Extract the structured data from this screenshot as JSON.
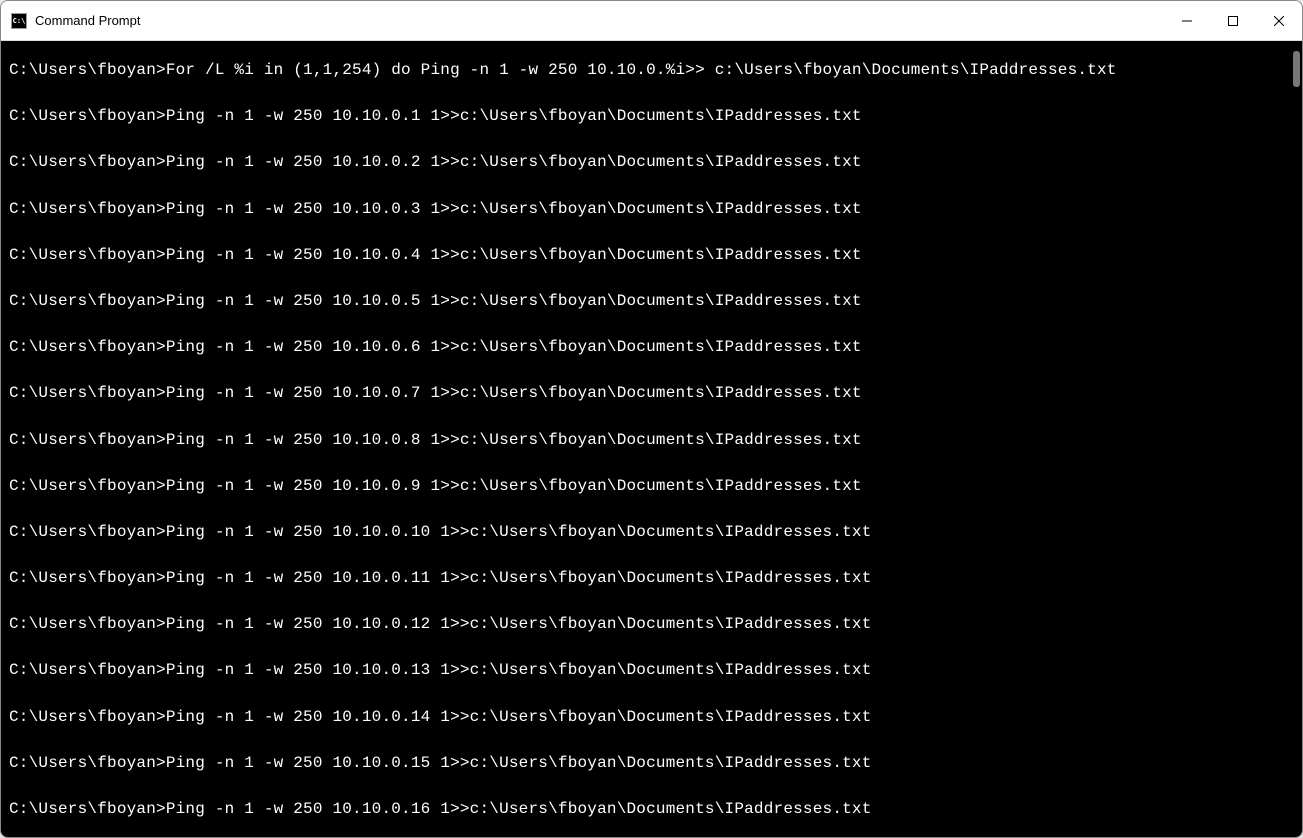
{
  "window": {
    "title": "Command Prompt",
    "icon_label": "C:\\"
  },
  "terminal": {
    "lines": [
      "C:\\Users\\fboyan>For /L %i in (1,1,254) do Ping -n 1 -w 250 10.10.0.%i>> c:\\Users\\fboyan\\Documents\\IPaddresses.txt",
      "",
      "C:\\Users\\fboyan>Ping -n 1 -w 250 10.10.0.1 1>>c:\\Users\\fboyan\\Documents\\IPaddresses.txt",
      "",
      "C:\\Users\\fboyan>Ping -n 1 -w 250 10.10.0.2 1>>c:\\Users\\fboyan\\Documents\\IPaddresses.txt",
      "",
      "C:\\Users\\fboyan>Ping -n 1 -w 250 10.10.0.3 1>>c:\\Users\\fboyan\\Documents\\IPaddresses.txt",
      "",
      "C:\\Users\\fboyan>Ping -n 1 -w 250 10.10.0.4 1>>c:\\Users\\fboyan\\Documents\\IPaddresses.txt",
      "",
      "C:\\Users\\fboyan>Ping -n 1 -w 250 10.10.0.5 1>>c:\\Users\\fboyan\\Documents\\IPaddresses.txt",
      "",
      "C:\\Users\\fboyan>Ping -n 1 -w 250 10.10.0.6 1>>c:\\Users\\fboyan\\Documents\\IPaddresses.txt",
      "",
      "C:\\Users\\fboyan>Ping -n 1 -w 250 10.10.0.7 1>>c:\\Users\\fboyan\\Documents\\IPaddresses.txt",
      "",
      "C:\\Users\\fboyan>Ping -n 1 -w 250 10.10.0.8 1>>c:\\Users\\fboyan\\Documents\\IPaddresses.txt",
      "",
      "C:\\Users\\fboyan>Ping -n 1 -w 250 10.10.0.9 1>>c:\\Users\\fboyan\\Documents\\IPaddresses.txt",
      "",
      "C:\\Users\\fboyan>Ping -n 1 -w 250 10.10.0.10 1>>c:\\Users\\fboyan\\Documents\\IPaddresses.txt",
      "",
      "C:\\Users\\fboyan>Ping -n 1 -w 250 10.10.0.11 1>>c:\\Users\\fboyan\\Documents\\IPaddresses.txt",
      "",
      "C:\\Users\\fboyan>Ping -n 1 -w 250 10.10.0.12 1>>c:\\Users\\fboyan\\Documents\\IPaddresses.txt",
      "",
      "C:\\Users\\fboyan>Ping -n 1 -w 250 10.10.0.13 1>>c:\\Users\\fboyan\\Documents\\IPaddresses.txt",
      "",
      "C:\\Users\\fboyan>Ping -n 1 -w 250 10.10.0.14 1>>c:\\Users\\fboyan\\Documents\\IPaddresses.txt",
      "",
      "C:\\Users\\fboyan>Ping -n 1 -w 250 10.10.0.15 1>>c:\\Users\\fboyan\\Documents\\IPaddresses.txt",
      "",
      "C:\\Users\\fboyan>Ping -n 1 -w 250 10.10.0.16 1>>c:\\Users\\fboyan\\Documents\\IPaddresses.txt"
    ]
  }
}
